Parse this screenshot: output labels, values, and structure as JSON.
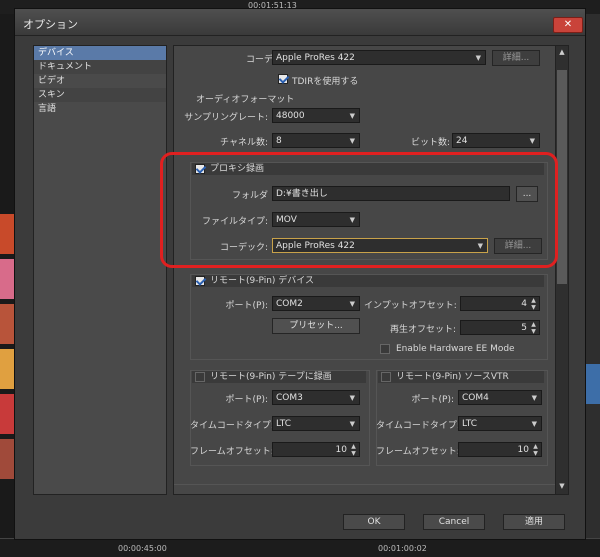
{
  "background": {
    "top_timecodes": [
      "00:01:51:13"
    ],
    "bottom_timecodes": [
      "00:00:45:00",
      "00:01:00:02"
    ]
  },
  "dialog": {
    "title": "オプション",
    "close_icon": "close-icon"
  },
  "categories": [
    "デバイス",
    "ドキュメント",
    "ビデオ",
    "スキン",
    "言語"
  ],
  "selected_category": "デバイス",
  "top": {
    "codec_label": "コーデック:",
    "codec_value": "Apple ProRes 422",
    "details_label": "詳細...",
    "tdir_label": "TDIRを使用する",
    "audio_format_label": "オーディオフォーマット",
    "sampling_label": "サンプリングレート:",
    "sampling_value": "48000",
    "channels_label": "チャネル数:",
    "channels_value": "8",
    "bits_label": "ビット数:",
    "bits_value": "24"
  },
  "proxy": {
    "header": "プロキシ録画",
    "folder_label": "フォルダ",
    "folder_value": "D:¥書き出し",
    "browse_label": "...",
    "filetype_label": "ファイルタイプ:",
    "filetype_value": "MOV",
    "codec_label": "コーデック:",
    "codec_value": "Apple ProRes 422",
    "details_label": "詳細..."
  },
  "remote_device": {
    "header": "リモート(9-Pin) デバイス",
    "port_label": "ポート(P):",
    "port_value": "COM2",
    "preset_label": "プリセット...",
    "input_offset_label": "インプットオフセット:",
    "input_offset_value": "4",
    "play_offset_label": "再生オフセット:",
    "play_offset_value": "5",
    "ee_mode_label": "Enable Hardware EE Mode"
  },
  "tape_record": {
    "header": "リモート(9-Pin) テープに録画",
    "port_label": "ポート(P):",
    "port_value": "COM3",
    "timecode_label": "タイムコードタイプ:",
    "timecode_value": "LTC",
    "frame_offset_label": "フレームオフセット:",
    "frame_offset_value": "10"
  },
  "source_vtr": {
    "header": "リモート(9-Pin) ソースVTR",
    "port_label": "ポート(P):",
    "port_value": "COM4",
    "timecode_label": "タイムコードタイプ:",
    "timecode_value": "LTC",
    "frame_offset_label": "フレームオフセット:",
    "frame_offset_value": "10"
  },
  "footer": {
    "ok": "OK",
    "cancel": "Cancel",
    "apply": "適用"
  },
  "colors": {
    "highlight_border": "#e02020",
    "selection": "#5a7aa8",
    "focus_border": "#c8a24a"
  }
}
